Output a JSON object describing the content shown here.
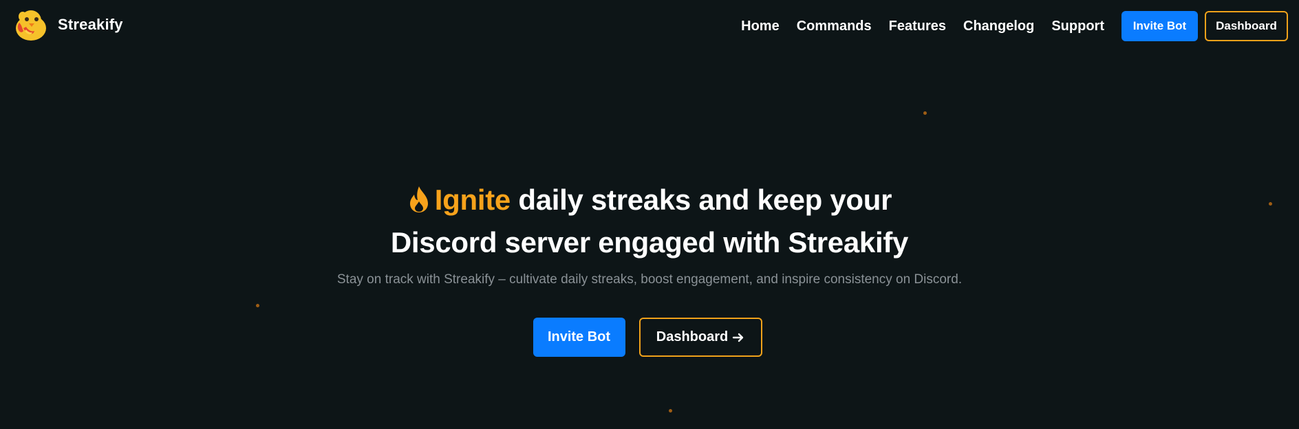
{
  "brand": {
    "name": "Streakify",
    "logo_icon": "chick-emoji-logo-icon"
  },
  "nav": {
    "links": [
      "Home",
      "Commands",
      "Features",
      "Changelog",
      "Support"
    ],
    "invite_label": "Invite Bot",
    "dashboard_label": "Dashboard"
  },
  "hero": {
    "title_icon": "flame-icon",
    "title_accent": "Ignite",
    "title_line1_rest": " daily streaks and keep your",
    "title_line2": "Discord server engaged with Streakify",
    "subtitle": "Stay on track with Streakify – cultivate daily streaks, boost engagement, and inspire consistency on Discord.",
    "invite_label": "Invite Bot",
    "dashboard_label": "Dashboard",
    "dashboard_icon": "arrow-right-icon"
  },
  "colors": {
    "background": "#0d1517",
    "accent_orange": "#f7a21b",
    "primary_blue": "#0a7cff",
    "subtitle_gray": "#8a9196"
  }
}
